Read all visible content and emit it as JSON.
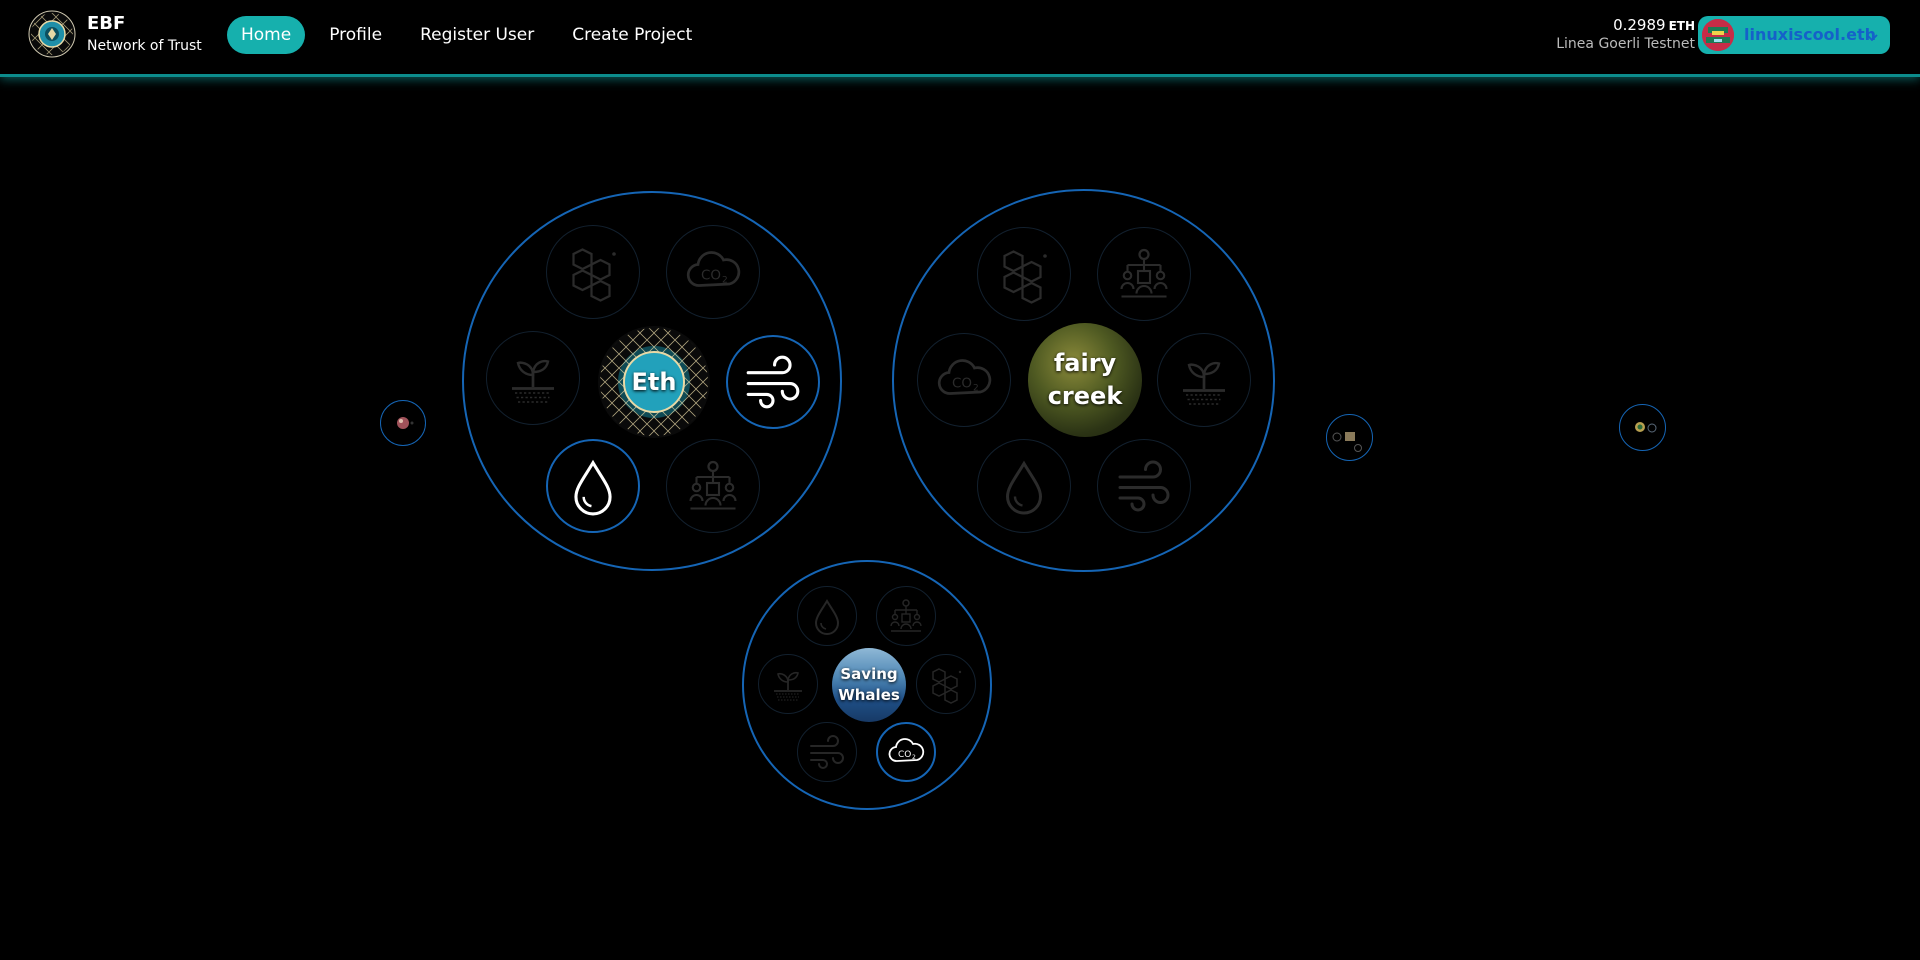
{
  "app": {
    "title": "EBF",
    "subtitle": "Network of Trust",
    "accent": "#16b0ad",
    "bubble_border": "#1565b5"
  },
  "nav": {
    "items": [
      {
        "label": "Home",
        "active": true
      },
      {
        "label": "Profile",
        "active": false
      },
      {
        "label": "Register User",
        "active": false
      },
      {
        "label": "Create Project",
        "active": false
      }
    ]
  },
  "wallet": {
    "balance": "0.2989",
    "unit": "ETH",
    "network": "Linea Goerli Testnet",
    "account": "linuxiscool.eth"
  },
  "bubbles": {
    "eth": {
      "label": "Eth",
      "icons": [
        "blockchain-hex-icon",
        "co2-cloud-icon",
        "sprout-icon",
        "wind-icon",
        "water-drop-icon",
        "org-chart-icon"
      ],
      "highlighted": [
        "wind-icon",
        "water-drop-icon"
      ]
    },
    "fairy_creek": {
      "label_line1": "fairy",
      "label_line2": "creek",
      "icons": [
        "blockchain-hex-icon",
        "org-chart-icon",
        "co2-cloud-icon",
        "sprout-icon",
        "water-drop-icon",
        "wind-icon"
      ],
      "highlighted": []
    },
    "saving_whales": {
      "label_line1": "Saving",
      "label_line2": "Whales",
      "icons": [
        "water-drop-icon",
        "org-chart-icon",
        "sprout-icon",
        "blockchain-hex-icon",
        "wind-icon",
        "co2-cloud-icon"
      ],
      "highlighted": [
        "co2-cloud-icon"
      ]
    }
  }
}
